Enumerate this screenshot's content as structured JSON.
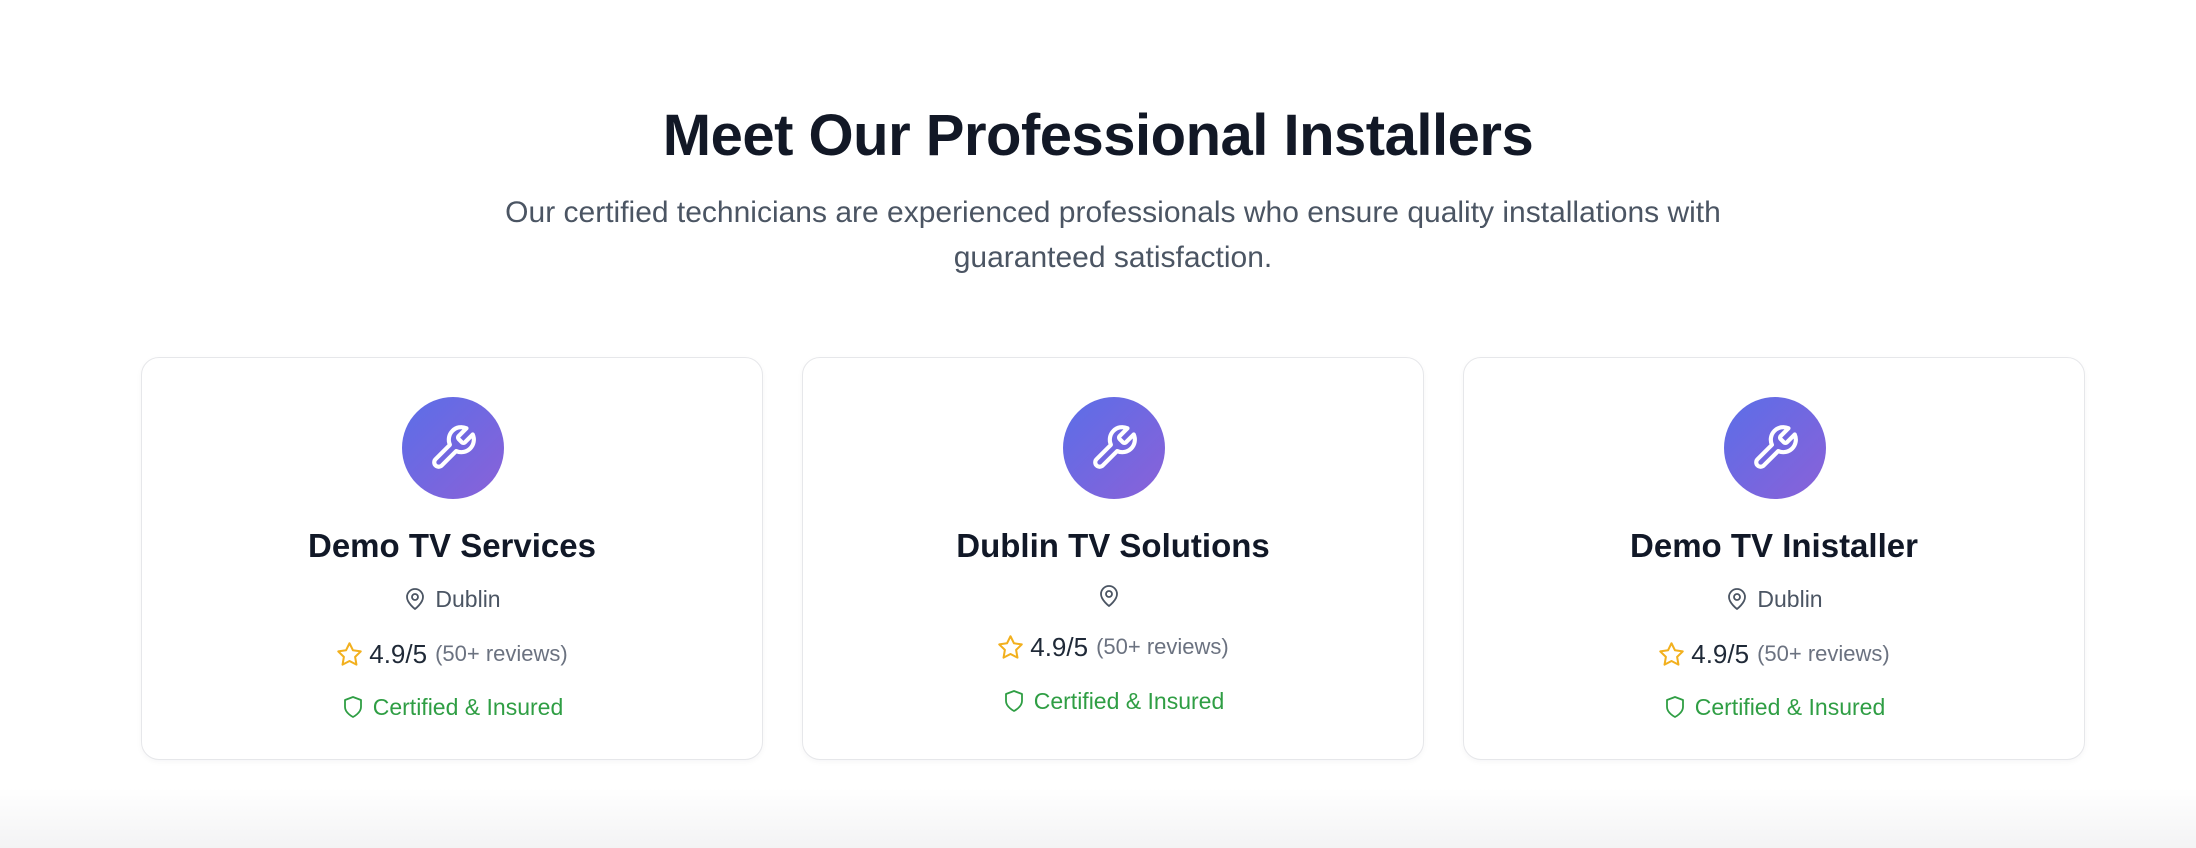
{
  "section": {
    "heading": "Meet Our Professional Installers",
    "subtitle": "Our certified technicians are experienced professionals who ensure quality installations with guaranteed satisfaction."
  },
  "colors": {
    "accent_gradient_start": "#5b6ee8",
    "accent_gradient_end": "#8a61d8",
    "star": "#f2b01e",
    "certified": "#2f9e44",
    "heading": "#121826"
  },
  "installers": [
    {
      "name": "Demo TV Services",
      "location": "Dublin",
      "rating": "4.9/5",
      "reviews": "(50+ reviews)",
      "certification": "Certified & Insured",
      "avatar_icon": "wrench-icon"
    },
    {
      "name": "Dublin TV Solutions",
      "location": "",
      "rating": "4.9/5",
      "reviews": "(50+ reviews)",
      "certification": "Certified & Insured",
      "avatar_icon": "wrench-icon"
    },
    {
      "name": "Demo TV Inistaller",
      "location": "Dublin",
      "rating": "4.9/5",
      "reviews": "(50+ reviews)",
      "certification": "Certified & Insured",
      "avatar_icon": "wrench-icon"
    }
  ]
}
